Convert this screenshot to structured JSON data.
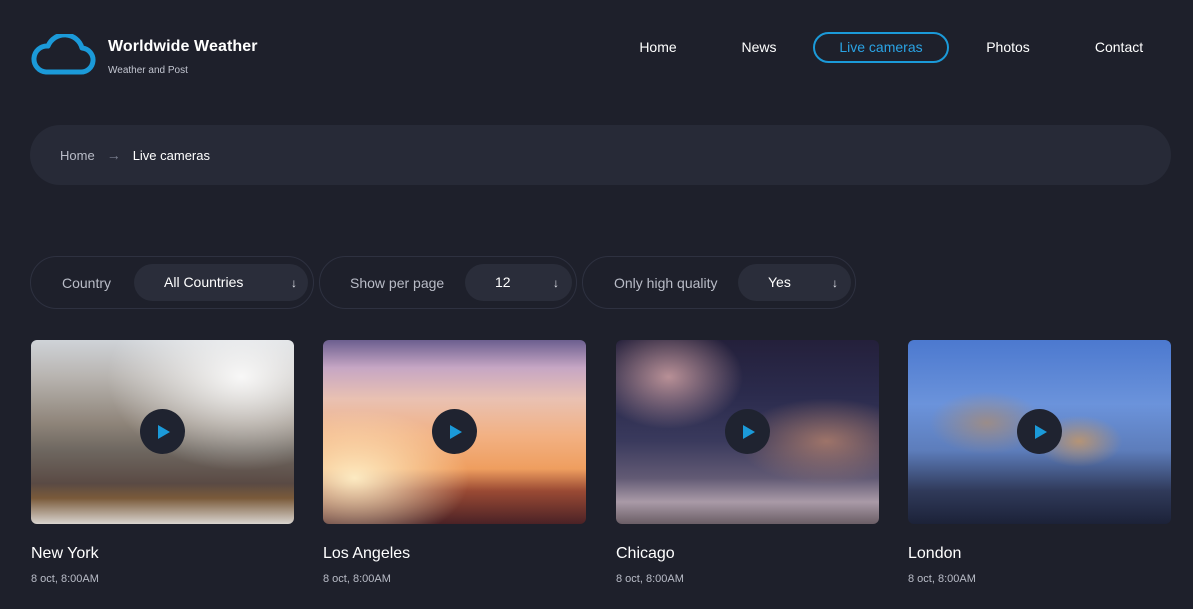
{
  "brand": {
    "title": "Worldwide Weather",
    "subtitle": "Weather and Post",
    "icon": "cloud-icon",
    "accent": "#1b9ad9"
  },
  "nav": {
    "items": [
      {
        "label": "Home"
      },
      {
        "label": "News"
      },
      {
        "label": "Live cameras",
        "active": true
      },
      {
        "label": "Photos"
      },
      {
        "label": "Contact"
      }
    ]
  },
  "breadcrumb": {
    "home": "Home",
    "separator": "→",
    "current": "Live cameras"
  },
  "filters": {
    "country": {
      "label": "Country",
      "value": "All Countries"
    },
    "per_page": {
      "label": "Show per page",
      "value": "12"
    },
    "quality": {
      "label": "Only high quality",
      "value": "Yes"
    },
    "arrow": "↓"
  },
  "cameras": [
    {
      "city": "New York",
      "date": "8 oct, 8:00AM"
    },
    {
      "city": "Los Angeles",
      "date": "8 oct, 8:00AM"
    },
    {
      "city": "Chicago",
      "date": "8 oct, 8:00AM"
    },
    {
      "city": "London",
      "date": "8 oct, 8:00AM"
    }
  ]
}
